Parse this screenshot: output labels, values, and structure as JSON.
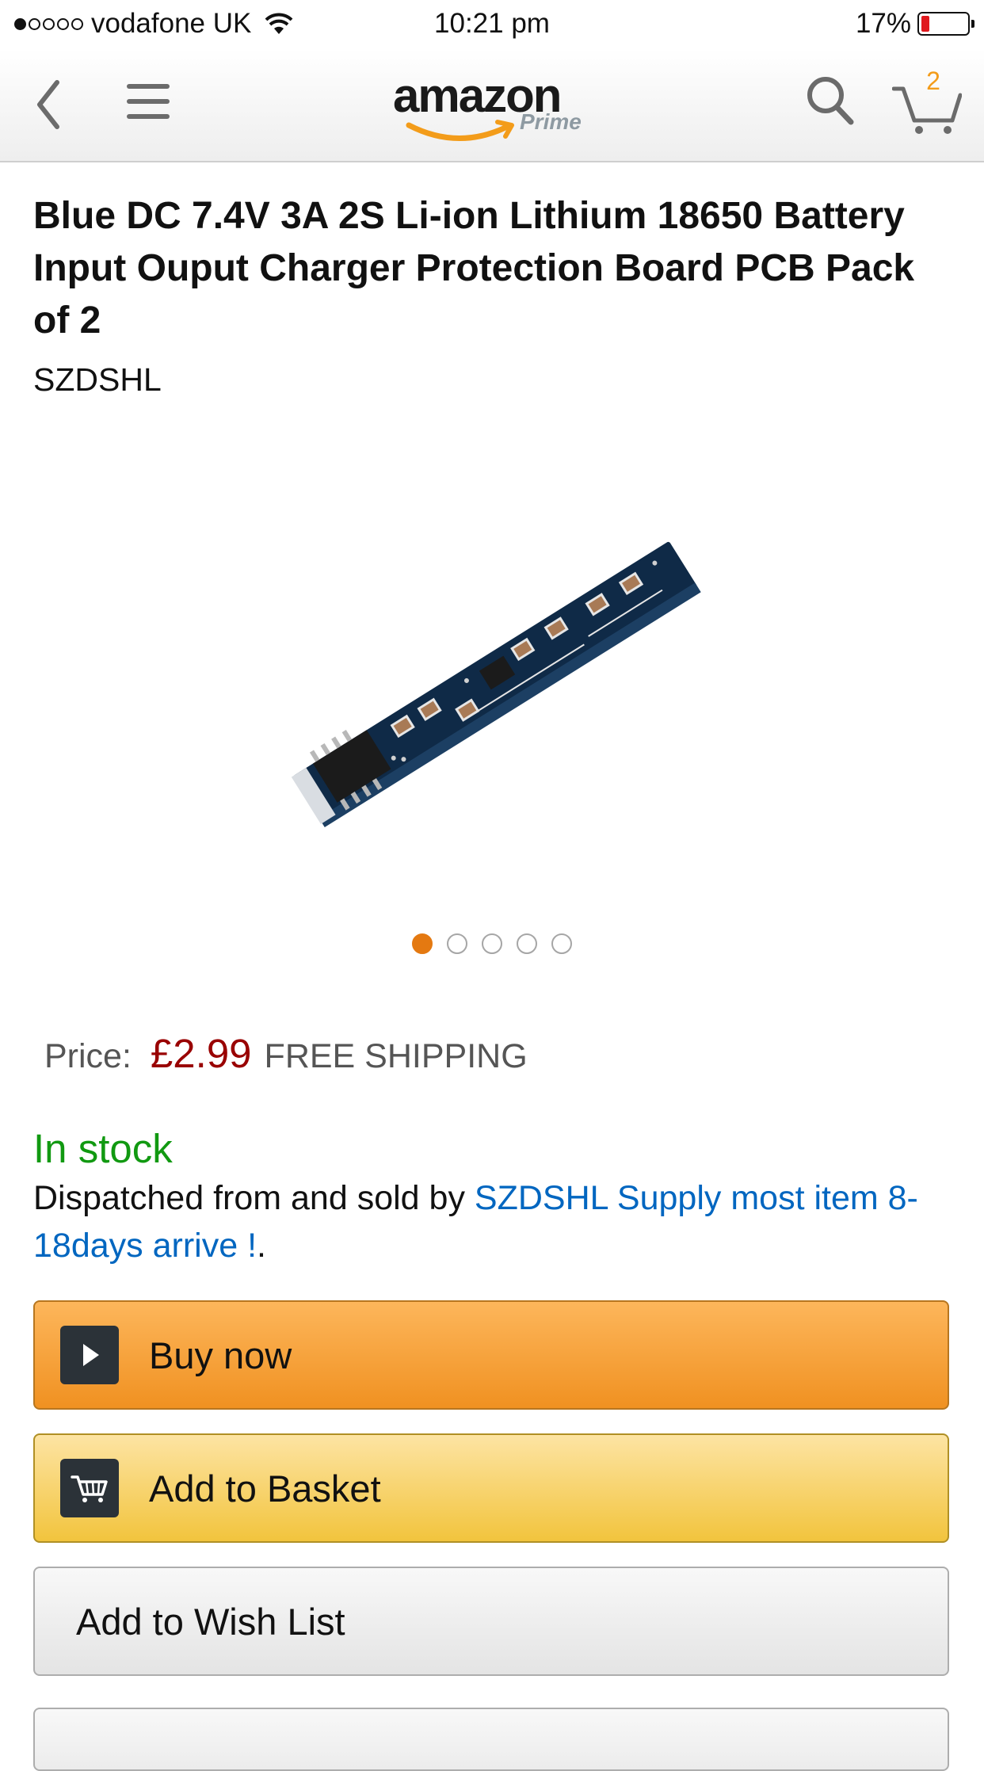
{
  "status_bar": {
    "carrier": "vodafone UK",
    "time": "10:21 pm",
    "battery": "17%",
    "battery_level": 0.17
  },
  "nav": {
    "logo_text": "amazon",
    "logo_sub": "Prime",
    "cart_count": "2"
  },
  "product": {
    "title": "Blue DC 7.4V 3A 2S Li-ion Lithium 18650 Battery Input Ouput Charger Protection Board PCB Pack of 2",
    "brand": "SZDSHL",
    "image_count": 5,
    "active_image": 1
  },
  "pricing": {
    "label": "Price:",
    "price": "£2.99",
    "shipping": "FREE SHIPPING"
  },
  "availability": {
    "stock": "In stock",
    "dispatch_prefix": "Dispatched from and sold by ",
    "seller": "SZDSHL Supply most item 8-18days arrive !",
    "dispatch_suffix": "."
  },
  "actions": {
    "buy_now": "Buy now",
    "add_to_basket": "Add to Basket",
    "add_to_wish_list": "Add to Wish List"
  },
  "colors": {
    "accent": "#e47911",
    "price": "#990000",
    "stock": "#119911",
    "link": "#0066c0"
  },
  "icons": [
    "back-icon",
    "menu-icon",
    "search-icon",
    "cart-icon",
    "play-icon",
    "cart-small-icon",
    "wifi-icon",
    "battery-icon"
  ]
}
